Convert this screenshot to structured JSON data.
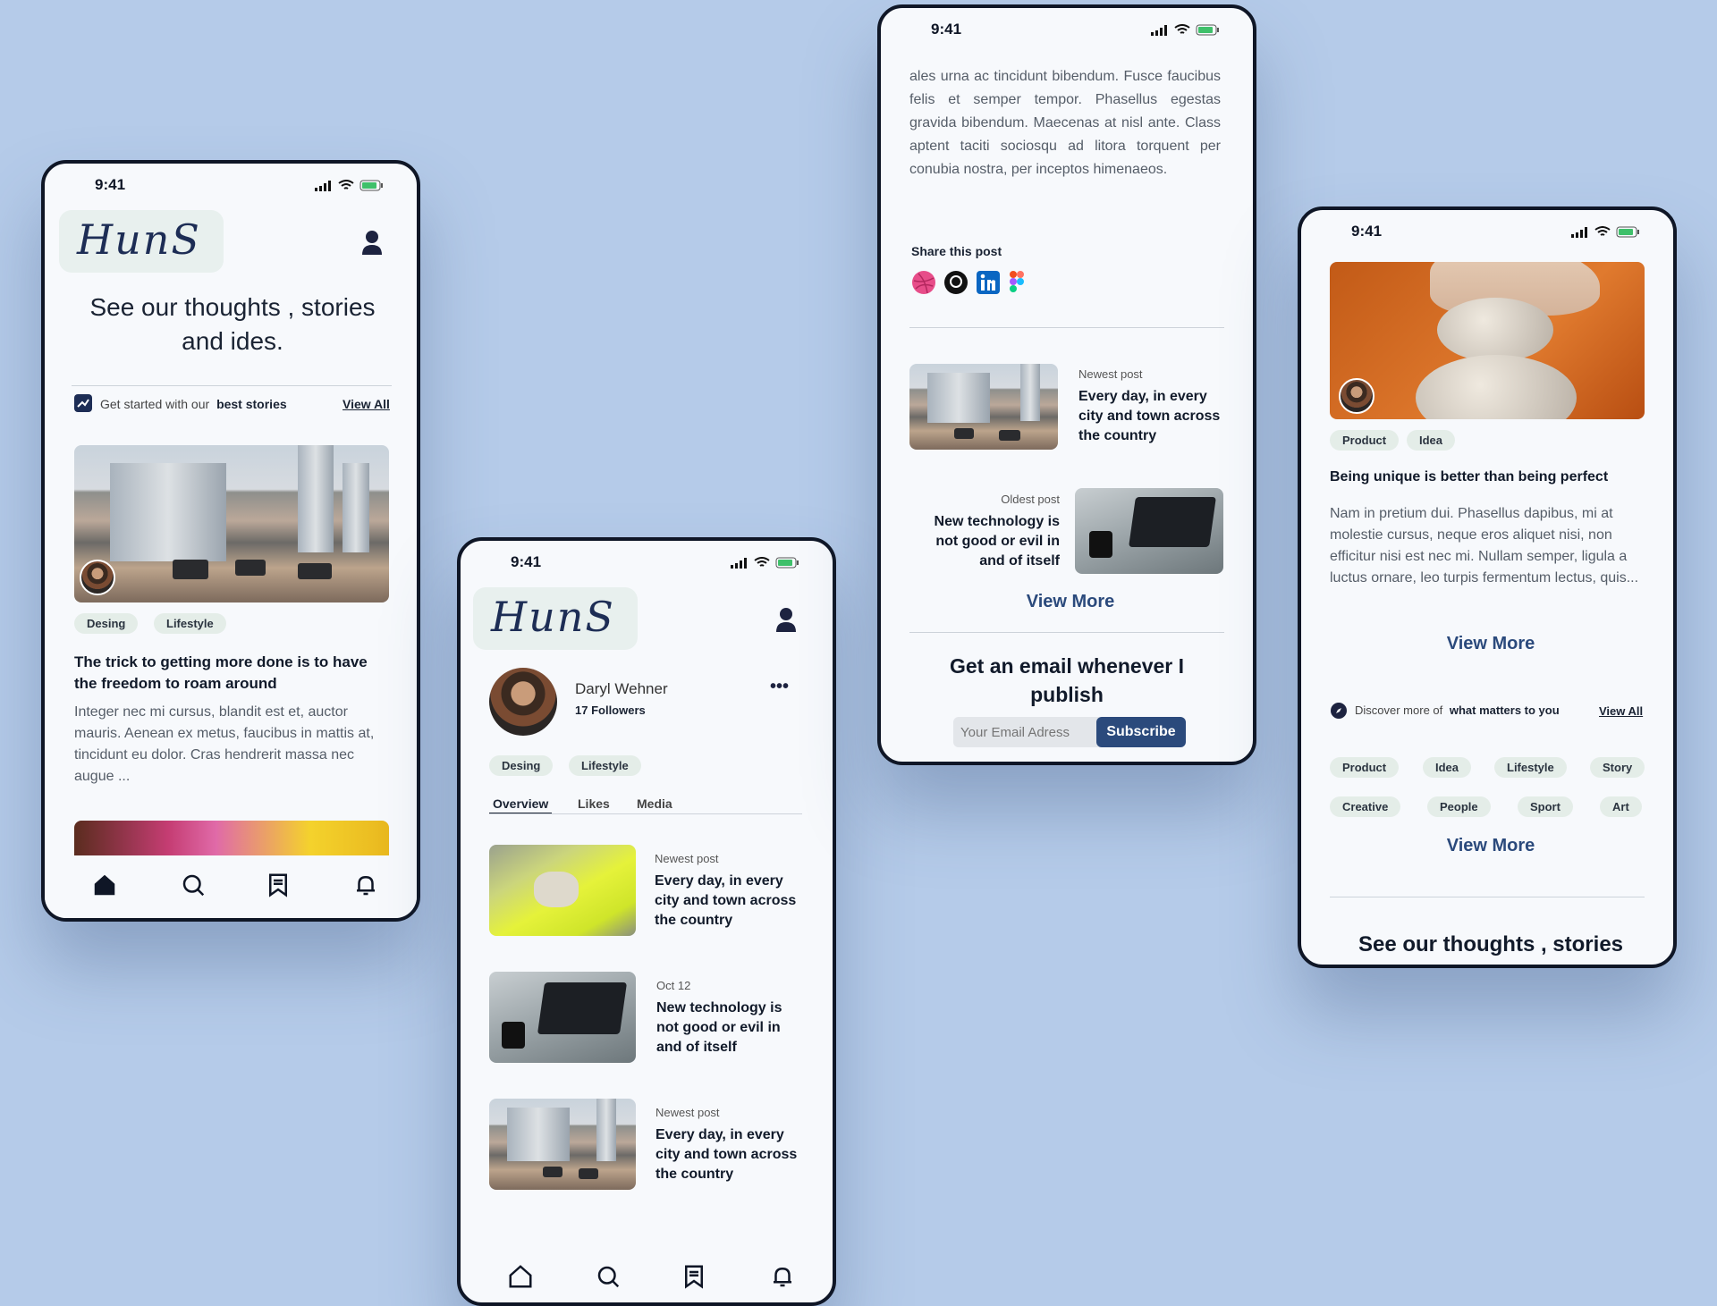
{
  "colors": {
    "background": "#b5cbe9",
    "phone_bg": "#f7f9fc",
    "frame": "#0f1626",
    "tag_bg": "#e4ede8",
    "link": "#2b4a7c",
    "subscribe": "#2b4a7c"
  },
  "status": {
    "time": "9:41"
  },
  "brand": {
    "logo_text": "HunS"
  },
  "p1": {
    "headline": "See our thoughts , stories and ides.",
    "started_prefix": "Get started with our",
    "started_bold": "best stories",
    "view_all": "View All",
    "tags": [
      "Desing",
      "Lifestyle"
    ],
    "post_title": "The trick to getting more done is to have the freedom to roam around",
    "post_body": "Integer nec mi cursus, blandit est et, auctor mauris. Aenean ex metus, faucibus in mattis at, tincidunt eu dolor. Cras hendrerit massa nec augue ...",
    "nav": [
      "home-icon",
      "search-icon",
      "bookmark-icon",
      "bell-icon"
    ]
  },
  "p2": {
    "name": "Daryl Wehner",
    "followers": "17 Followers",
    "more": "•••",
    "tags": [
      "Desing",
      "Lifestyle"
    ],
    "tabs": [
      "Overview",
      "Likes",
      "Media"
    ],
    "posts": [
      {
        "meta": "Newest post",
        "title": "Every day, in every city and town across the country"
      },
      {
        "meta": "Oct 12",
        "title": "New technology is not good or evil in and of itself"
      },
      {
        "meta": "Newest post",
        "title": "Every day, in every city and town across the country"
      }
    ]
  },
  "p3": {
    "body": "ales urna ac tincidunt bibendum. Fusce faucibus felis et semper tempor. Phasellus egestas gravida bibendum. Maecenas at nisl ante. Class aptent taciti sociosqu ad litora torquent per conubia nostra, per inceptos himenaeos.",
    "share_label": "Share this post",
    "share_icons": [
      "dribbble-icon",
      "github-icon",
      "linkedin-icon",
      "figma-icon"
    ],
    "post1": {
      "meta": "Newest post",
      "title": "Every day, in every city and town across the country"
    },
    "post2": {
      "meta": "Oldest post",
      "title": "New technology is not good or evil in and of itself"
    },
    "view_more": "View More",
    "email_heading": "Get an email whenever I publish",
    "email_placeholder": "Your Email Adress",
    "subscribe": "Subscribe"
  },
  "p4": {
    "tags": [
      "Product",
      "Idea"
    ],
    "title": "Being unique is better than being perfect",
    "body": "Nam in pretium dui. Phasellus dapibus, mi at molestie cursus, neque eros aliquet nisi, non efficitur nisi est nec mi. Nullam semper, ligula a luctus ornare, leo turpis fermentum lectus, quis...",
    "view_more": "View More",
    "discover_prefix": "Discover more of",
    "discover_bold": "what matters to you",
    "view_all": "View All",
    "topics": [
      "Product",
      "Idea",
      "Lifestyle",
      "Story",
      "Creative",
      "People",
      "Sport",
      "Art"
    ],
    "view_more_2": "View More",
    "footer_heading": "See our thoughts , stories"
  }
}
